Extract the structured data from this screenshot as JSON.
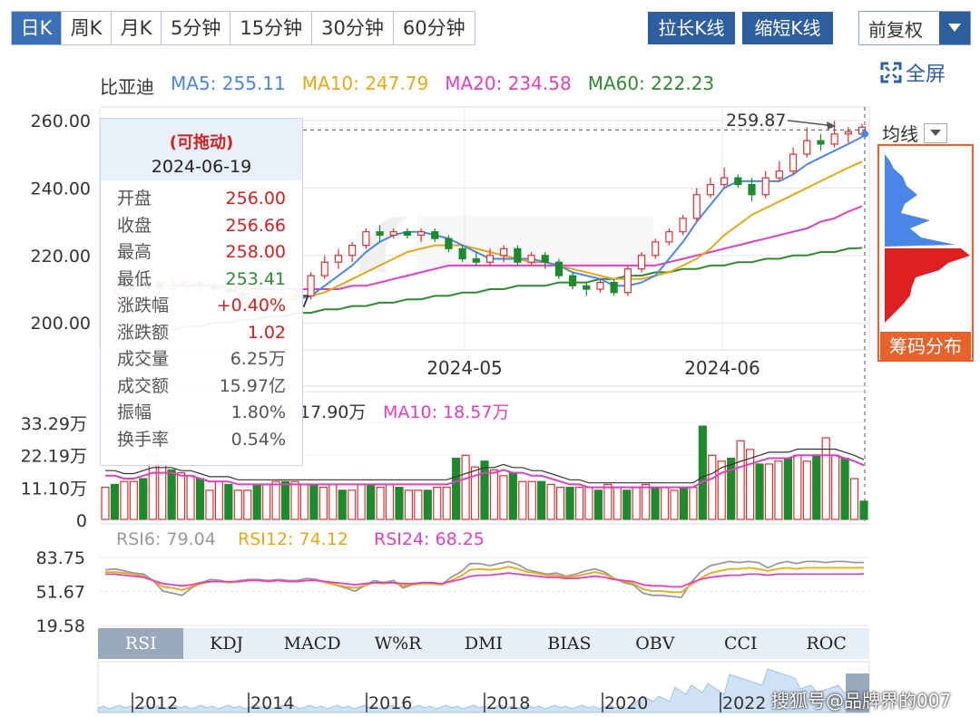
{
  "toolbar": {
    "tabs": [
      "日K",
      "周K",
      "月K",
      "5分钟",
      "15分钟",
      "30分钟",
      "60分钟"
    ],
    "lengthen_label": "拉长K线",
    "shorten_label": "缩短K线",
    "adjust_label": "前复权",
    "fullscreen_label": "全屏"
  },
  "ma_legend": {
    "name": "比亚迪",
    "items": [
      {
        "label": "MA5: 255.11",
        "color": "#4a86e8"
      },
      {
        "label": "MA10: 247.79",
        "color": "#e6a817"
      },
      {
        "label": "MA20: 234.58",
        "color": "#e040c0"
      },
      {
        "label": "MA60: 222.23",
        "color": "#2e8b2e"
      }
    ]
  },
  "info_panel": {
    "drag_label": "(可拖动)",
    "date": "2024-06-19",
    "rows": [
      {
        "k": "开盘",
        "v": "256.00",
        "color": "#d02020"
      },
      {
        "k": "收盘",
        "v": "256.66",
        "color": "#d02020"
      },
      {
        "k": "最高",
        "v": "258.00",
        "color": "#d02020"
      },
      {
        "k": "最低",
        "v": "253.41",
        "color": "#2e8b2e"
      },
      {
        "k": "涨跌幅",
        "v": "+0.40%",
        "color": "#d02020"
      },
      {
        "k": "涨跌额",
        "v": "1.02",
        "color": "#d02020"
      },
      {
        "k": "成交量",
        "v": "6.25万",
        "color": "#555"
      },
      {
        "k": "成交额",
        "v": "15.97亿",
        "color": "#555"
      },
      {
        "k": "振幅",
        "v": "1.80%",
        "color": "#555"
      },
      {
        "k": "换手率",
        "v": "0.54%",
        "color": "#555"
      }
    ]
  },
  "side": {
    "avg_label": "均线",
    "chip_label": "筹码分布"
  },
  "indicator_tabs": [
    "RSI",
    "KDJ",
    "MACD",
    "W%R",
    "DMI",
    "BIAS",
    "OBV",
    "CCI",
    "ROC"
  ],
  "watermark": "搜狐号@品牌界的007",
  "colors": {
    "up": "#e03030",
    "down": "#1e8a2e",
    "accent": "#2f5e9f"
  },
  "chart_data": [
    {
      "type": "candlestick",
      "ylim": [
        192,
        264
      ],
      "y_ticks": [
        "260.00",
        "240.00",
        "220.00",
        "200.00"
      ],
      "x_labels": [
        "2024-05",
        "2024-06"
      ],
      "high_marker": "259.87",
      "low_marker_partial": "7",
      "candles": [
        [
          209,
          211,
          208,
          213
        ],
        [
          211,
          210,
          208,
          213
        ],
        [
          210,
          212,
          208,
          214
        ],
        [
          212,
          210,
          208,
          213
        ],
        [
          210,
          211,
          208,
          213
        ],
        [
          211,
          212,
          209,
          214
        ],
        [
          212,
          211,
          209,
          213
        ],
        [
          211,
          210,
          208,
          212
        ],
        [
          210,
          209,
          207,
          212
        ],
        [
          209,
          207,
          205,
          210
        ],
        [
          207,
          205,
          204,
          209
        ],
        [
          205,
          206,
          204,
          208
        ],
        [
          206,
          207,
          205,
          209
        ],
        [
          207,
          208,
          206,
          210
        ],
        [
          208,
          214,
          207,
          215
        ],
        [
          214,
          218,
          213,
          220
        ],
        [
          218,
          220,
          216,
          222
        ],
        [
          220,
          223,
          218,
          224
        ],
        [
          223,
          227,
          222,
          228
        ],
        [
          227,
          226,
          224,
          229
        ],
        [
          226,
          227,
          225,
          228
        ],
        [
          227,
          226,
          225,
          228
        ],
        [
          226,
          227,
          224,
          228
        ],
        [
          227,
          225,
          224,
          228
        ],
        [
          225,
          222,
          221,
          226
        ],
        [
          222,
          219,
          218,
          223
        ],
        [
          219,
          218,
          217,
          221
        ],
        [
          218,
          220,
          217,
          222
        ],
        [
          220,
          222,
          218,
          223
        ],
        [
          222,
          218,
          217,
          223
        ],
        [
          218,
          220,
          217,
          221
        ],
        [
          220,
          218,
          216,
          221
        ],
        [
          218,
          214,
          213,
          219
        ],
        [
          214,
          211,
          210,
          215
        ],
        [
          211,
          210,
          208,
          212
        ],
        [
          210,
          212,
          209,
          213
        ],
        [
          212,
          209,
          208,
          213
        ],
        [
          209,
          216,
          208,
          217
        ],
        [
          216,
          220,
          215,
          221
        ],
        [
          220,
          224,
          219,
          225
        ],
        [
          224,
          227,
          223,
          228
        ],
        [
          227,
          231,
          226,
          232
        ],
        [
          231,
          238,
          230,
          240
        ],
        [
          238,
          241,
          237,
          243
        ],
        [
          241,
          243,
          240,
          246
        ],
        [
          243,
          241,
          240,
          244
        ],
        [
          241,
          238,
          236,
          243
        ],
        [
          238,
          243,
          237,
          245
        ],
        [
          243,
          245,
          242,
          248
        ],
        [
          245,
          250,
          244,
          252
        ],
        [
          250,
          254,
          249,
          258
        ],
        [
          254,
          253,
          251,
          256
        ],
        [
          253,
          256,
          252,
          259.87
        ],
        [
          256,
          256.66,
          253.41,
          258
        ],
        [
          256,
          258,
          255,
          259
        ]
      ],
      "ma5": [
        211,
        211,
        211,
        211,
        211,
        211,
        211,
        211,
        210,
        209,
        208,
        207,
        207,
        207,
        208,
        211,
        214,
        217,
        221,
        224,
        226,
        227,
        227,
        226,
        225,
        223,
        221,
        219,
        219,
        219,
        219,
        218,
        217,
        215,
        214,
        213,
        211,
        211,
        212,
        214,
        219,
        224,
        230,
        235,
        240,
        242,
        242,
        242,
        242,
        244,
        247,
        249,
        251,
        253,
        255.11
      ],
      "ma10": [
        212,
        212,
        212,
        212,
        212,
        211,
        211,
        211,
        210,
        210,
        209,
        208,
        208,
        208,
        208,
        209,
        211,
        213,
        215,
        217,
        219,
        221,
        222,
        223,
        223,
        223,
        222,
        221,
        220,
        219,
        218,
        218,
        217,
        216,
        215,
        214,
        213,
        213,
        213,
        214,
        215,
        217,
        219,
        222,
        226,
        229,
        232,
        234,
        236,
        238,
        240,
        242,
        244,
        246,
        247.79
      ],
      "ma20": [
        211,
        211,
        211,
        211,
        211,
        211,
        211,
        211,
        211,
        211,
        210,
        210,
        210,
        210,
        210,
        210,
        210,
        211,
        211,
        212,
        213,
        214,
        215,
        216,
        217,
        217,
        217,
        217,
        217,
        217,
        217,
        217,
        217,
        217,
        217,
        217,
        217,
        217,
        217,
        217,
        218,
        219,
        220,
        221,
        222,
        223,
        224,
        225,
        226,
        227,
        228,
        230,
        231,
        233,
        234.58
      ],
      "ma60": [
        196,
        197,
        197,
        198,
        198,
        199,
        199,
        200,
        200,
        201,
        201,
        202,
        202,
        203,
        203,
        204,
        204,
        205,
        205,
        206,
        206,
        207,
        207,
        208,
        208,
        209,
        209,
        210,
        210,
        211,
        211,
        211,
        212,
        212,
        212,
        213,
        213,
        214,
        214,
        215,
        215,
        216,
        216,
        217,
        217,
        218,
        218,
        219,
        219,
        220,
        220,
        221,
        221,
        222,
        222.23
      ]
    },
    {
      "type": "bar",
      "title": "成交量",
      "legend": [
        "17.90万",
        "MA10: 18.57万"
      ],
      "ylim": [
        0,
        33.29
      ],
      "y_ticks": [
        "33.29万",
        "22.19万",
        "11.10万",
        "0"
      ],
      "volumes": [
        11,
        12,
        13,
        13,
        14,
        22,
        20,
        17,
        16,
        15,
        14,
        10,
        13,
        12,
        10,
        10,
        12,
        12,
        13,
        13,
        13,
        12,
        12,
        11,
        12,
        10,
        10,
        12,
        12,
        11,
        12,
        11,
        10,
        10,
        10,
        11,
        11,
        21,
        22,
        18,
        20,
        17,
        15,
        16,
        13,
        13,
        13,
        12,
        11,
        11,
        11,
        11,
        10,
        12,
        11,
        10,
        11,
        12,
        11,
        11,
        10,
        11,
        11,
        32,
        22,
        20,
        21,
        27,
        24,
        19,
        19,
        20,
        21,
        22,
        20,
        22,
        28,
        22,
        21,
        14,
        6.25
      ],
      "vma": [
        15,
        15,
        14,
        14,
        15,
        16,
        16,
        16,
        15,
        15,
        14,
        13,
        13,
        13,
        12,
        12,
        12,
        12,
        12,
        12,
        12,
        12,
        12,
        12,
        12,
        12,
        12,
        12,
        12,
        12,
        12,
        12,
        12,
        12,
        12,
        12,
        12,
        13,
        14,
        15,
        16,
        16,
        17,
        16,
        16,
        15,
        15,
        14,
        13,
        12,
        12,
        11,
        11,
        11,
        11,
        11,
        11,
        11,
        11,
        11,
        11,
        11,
        11,
        13,
        14,
        16,
        17,
        18,
        19,
        20,
        21,
        21,
        21,
        22,
        22,
        22,
        22,
        22,
        21,
        20,
        18.57
      ]
    },
    {
      "type": "line",
      "title": "RSI",
      "legend": [
        {
          "label": "RSI6: 79.04",
          "color": "#999999"
        },
        {
          "label": "RSI12: 74.12",
          "color": "#e6a817"
        },
        {
          "label": "RSI24: 68.25",
          "color": "#e040c0"
        }
      ],
      "y_ticks": [
        "83.75",
        "51.67",
        "19.58"
      ],
      "ylim": [
        19.58,
        83.75
      ],
      "rsi6": [
        72,
        73,
        71,
        69,
        68,
        62,
        52,
        50,
        48,
        55,
        60,
        63,
        62,
        60,
        62,
        63,
        63,
        62,
        63,
        62,
        62,
        64,
        63,
        60,
        58,
        55,
        52,
        57,
        62,
        60,
        62,
        55,
        58,
        60,
        60,
        58,
        65,
        70,
        78,
        78,
        76,
        78,
        80,
        77,
        72,
        70,
        68,
        69,
        66,
        68,
        71,
        73,
        70,
        64,
        60,
        58,
        50,
        48,
        48,
        47,
        46,
        60,
        70,
        76,
        78,
        80,
        79,
        80,
        79,
        74,
        78,
        80,
        78,
        80,
        80,
        79,
        80,
        80,
        79,
        79.04
      ],
      "rsi12": [
        70,
        70,
        69,
        68,
        66,
        62,
        56,
        55,
        53,
        56,
        59,
        61,
        61,
        60,
        61,
        62,
        62,
        61,
        62,
        61,
        61,
        62,
        62,
        60,
        58,
        56,
        55,
        57,
        60,
        59,
        60,
        57,
        58,
        59,
        59,
        58,
        62,
        66,
        72,
        73,
        72,
        73,
        75,
        73,
        70,
        69,
        67,
        67,
        65,
        66,
        68,
        70,
        68,
        64,
        61,
        59,
        54,
        52,
        52,
        51,
        51,
        58,
        64,
        69,
        71,
        73,
        73,
        74,
        73,
        71,
        73,
        74,
        73,
        74,
        74,
        74,
        74,
        74,
        74,
        74.12
      ],
      "rsi24": [
        68,
        68,
        67,
        66,
        65,
        62,
        59,
        58,
        57,
        58,
        60,
        61,
        61,
        61,
        61,
        62,
        62,
        61,
        62,
        61,
        61,
        62,
        62,
        61,
        60,
        59,
        58,
        59,
        60,
        60,
        60,
        59,
        59,
        60,
        60,
        59,
        61,
        63,
        66,
        67,
        67,
        68,
        69,
        68,
        67,
        66,
        65,
        65,
        64,
        64,
        65,
        66,
        65,
        63,
        62,
        61,
        58,
        57,
        57,
        56,
        56,
        60,
        63,
        65,
        66,
        67,
        67,
        68,
        68,
        67,
        68,
        68,
        68,
        68,
        68,
        68,
        68,
        68,
        68,
        68.25
      ]
    },
    {
      "type": "area",
      "title": "历史缩略",
      "x_labels": [
        "2012",
        "2014",
        "2016",
        "2018",
        "2020",
        "2022"
      ]
    }
  ]
}
